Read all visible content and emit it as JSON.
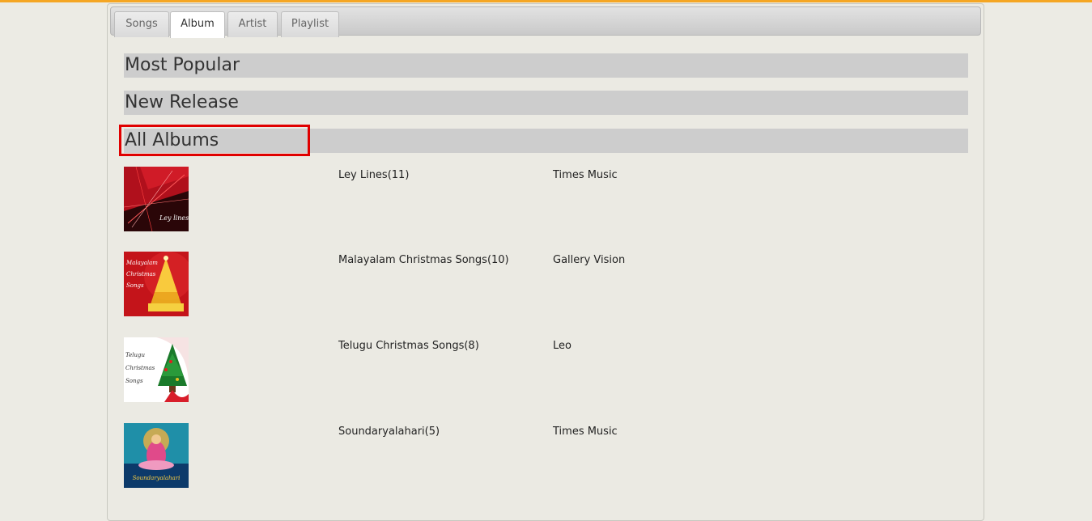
{
  "tabs": [
    {
      "label": "Songs",
      "active": false
    },
    {
      "label": "Album",
      "active": true
    },
    {
      "label": "Artist",
      "active": false
    },
    {
      "label": "Playlist",
      "active": false
    }
  ],
  "sections": {
    "most_popular": "Most Popular",
    "new_release": "New Release",
    "all_albums": "All Albums"
  },
  "albums": [
    {
      "title": "Ley Lines(11)",
      "label": "Times Music",
      "cover_text": "Ley lines"
    },
    {
      "title": "Malayalam Christmas Songs(10)",
      "label": "Gallery Vision",
      "cover_text": "Malayalam Christmas Songs"
    },
    {
      "title": "Telugu Christmas Songs(8)",
      "label": "Leo",
      "cover_text": "Telugu Christmas Songs"
    },
    {
      "title": "Soundaryalahari(5)",
      "label": "Times Music",
      "cover_text": "Soundaryalahari"
    }
  ],
  "colors": {
    "accent_top_bar": "#f5a623",
    "highlight_box": "#e00000",
    "section_header_bg": "#cdcdcd"
  }
}
